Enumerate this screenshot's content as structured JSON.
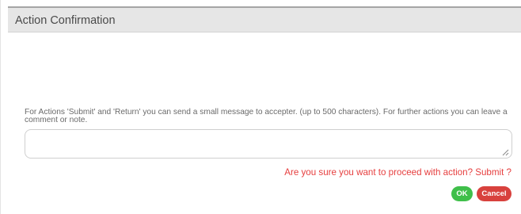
{
  "dialog": {
    "title": "Action Confirmation"
  },
  "message": {
    "text": "For Actions 'Submit' and 'Return' you can send a small message to accepter. (up to 500 characters). For further actions you can leave a comment or note."
  },
  "comment": {
    "value": "",
    "placeholder": ""
  },
  "confirmation": {
    "text": "Are you sure you want to proceed with action? Submit ?"
  },
  "buttons": {
    "ok_label": "OK",
    "cancel_label": "Cancel"
  },
  "colors": {
    "ok": "#3fbf4a",
    "cancel": "#d8413d",
    "confirmation_text": "#e63e3e",
    "titlebar": "#e6e6e6"
  }
}
